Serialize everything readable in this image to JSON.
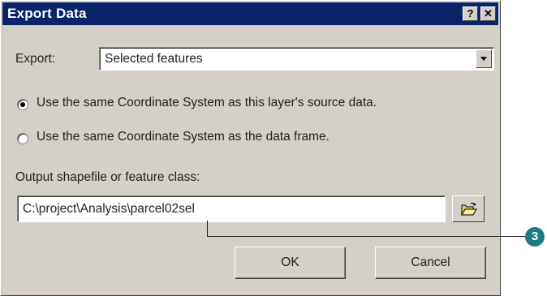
{
  "window": {
    "title": "Export Data",
    "help_label": "?",
    "close_label": "✕"
  },
  "export": {
    "label": "Export:",
    "selected": "Selected features"
  },
  "coordinate_system": {
    "options": [
      {
        "label": "Use the same Coordinate System as this layer's source data.",
        "checked": true
      },
      {
        "label": "Use the same Coordinate System as the data frame.",
        "checked": false
      }
    ]
  },
  "output": {
    "label": "Output shapefile or feature class:",
    "value": "C:\\project\\Analysis\\parcel02sel"
  },
  "buttons": {
    "ok": "OK",
    "cancel": "Cancel"
  },
  "callout": {
    "number": "3"
  }
}
